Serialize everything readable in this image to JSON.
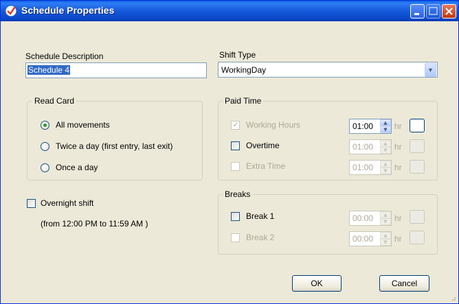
{
  "window": {
    "title": "Schedule Properties"
  },
  "description": {
    "label": "Schedule Description",
    "value": "Schedule 4"
  },
  "shift_type": {
    "label": "Shift Type",
    "value": "WorkingDay"
  },
  "read_card": {
    "title": "Read Card",
    "options": [
      {
        "label": "All movements",
        "selected": true
      },
      {
        "label": "Twice a day (first entry, last exit)",
        "selected": false
      },
      {
        "label": "Once a day",
        "selected": false
      }
    ]
  },
  "overnight": {
    "label": "Overnight shift",
    "checked": false,
    "note": "(from 12:00 PM to 11:59 AM )"
  },
  "paid_time": {
    "title": "Paid Time",
    "rows": [
      {
        "label": "Working Hours",
        "checked": true,
        "enabled": false,
        "time": "01:00",
        "unit": "hr"
      },
      {
        "label": "Overtime",
        "checked": false,
        "enabled": true,
        "time": "01:00",
        "unit": "hr"
      },
      {
        "label": "Extra Time",
        "checked": false,
        "enabled": false,
        "time": "01:00",
        "unit": "hr"
      }
    ]
  },
  "breaks": {
    "title": "Breaks",
    "rows": [
      {
        "label": "Break 1",
        "checked": false,
        "enabled": true,
        "time": "00:00",
        "unit": "hr"
      },
      {
        "label": "Break 2",
        "checked": false,
        "enabled": false,
        "time": "00:00",
        "unit": "hr"
      }
    ]
  },
  "buttons": {
    "ok": "OK",
    "cancel": "Cancel"
  }
}
